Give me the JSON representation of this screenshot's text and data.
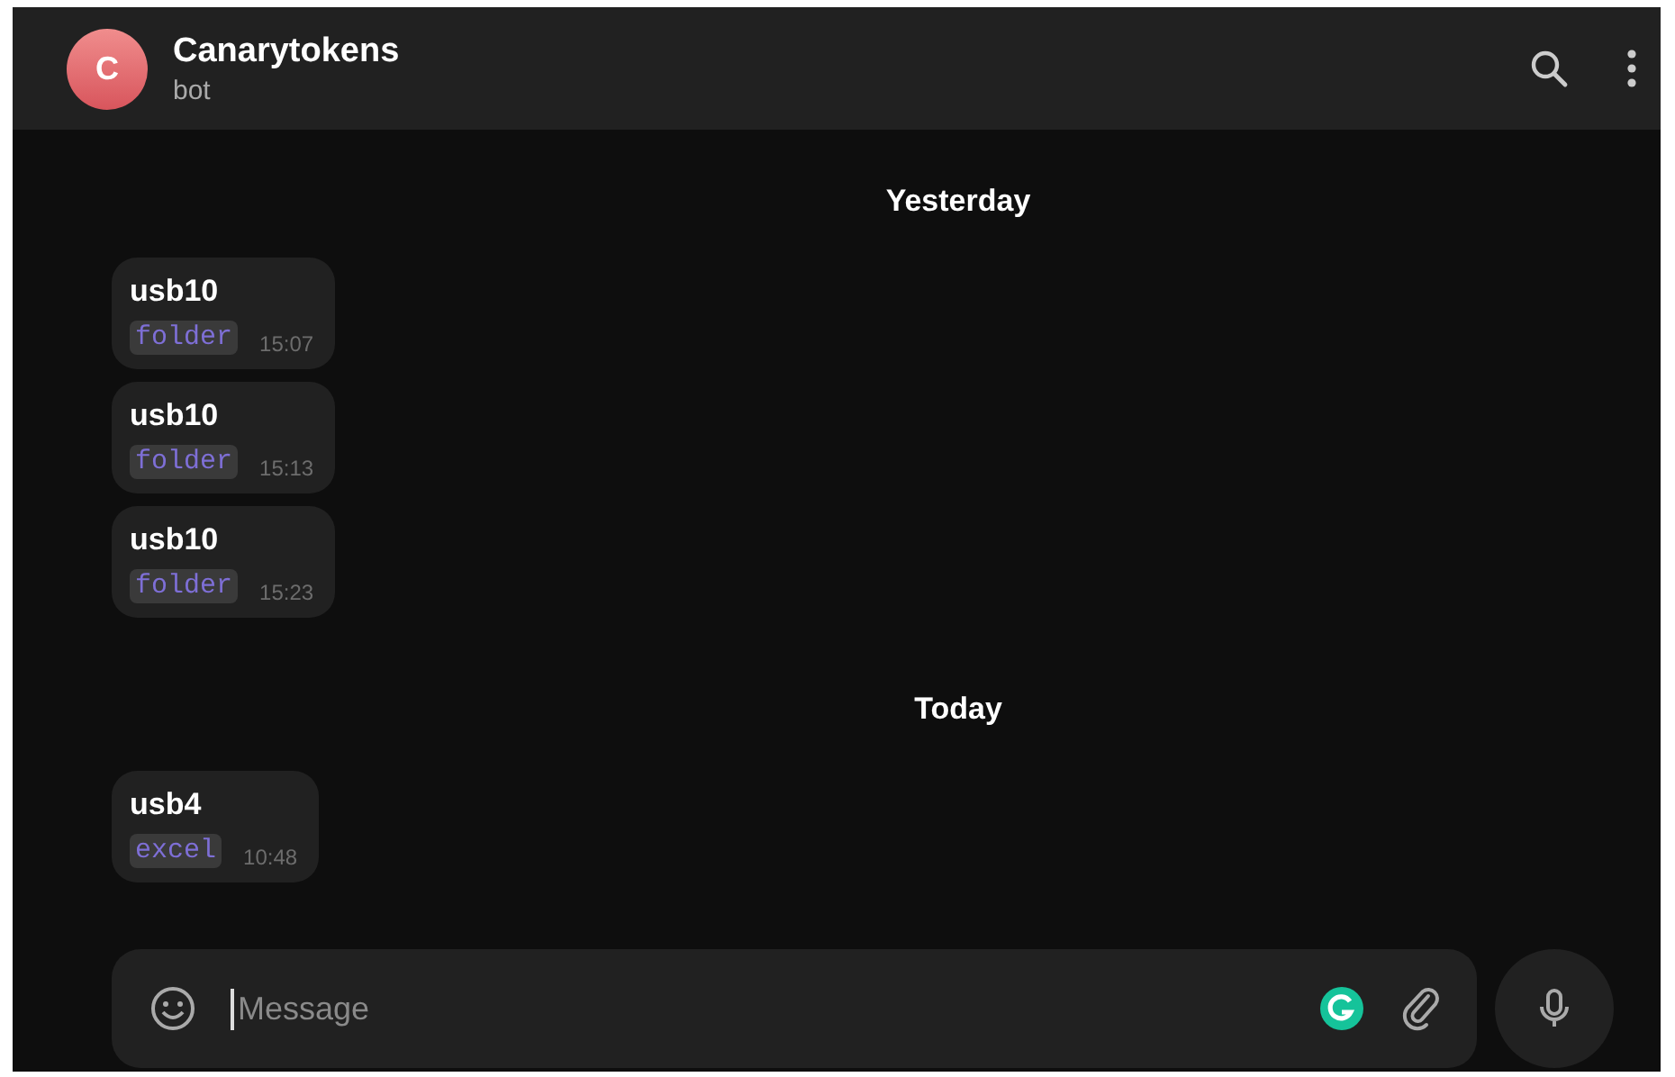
{
  "header": {
    "avatar_letter": "C",
    "title": "Canarytokens",
    "subtitle": "bot"
  },
  "messages": [
    {
      "kind": "date",
      "text": "Yesterday"
    },
    {
      "kind": "message",
      "text": "usb10",
      "tag": "folder",
      "time": "15:07"
    },
    {
      "kind": "message",
      "text": "usb10",
      "tag": "folder",
      "time": "15:13"
    },
    {
      "kind": "message",
      "text": "usb10",
      "tag": "folder",
      "time": "15:23"
    },
    {
      "kind": "date",
      "text": "Today"
    },
    {
      "kind": "message",
      "text": "usb4",
      "tag": "excel",
      "time": "10:48"
    }
  ],
  "composer": {
    "placeholder": "Message"
  }
}
